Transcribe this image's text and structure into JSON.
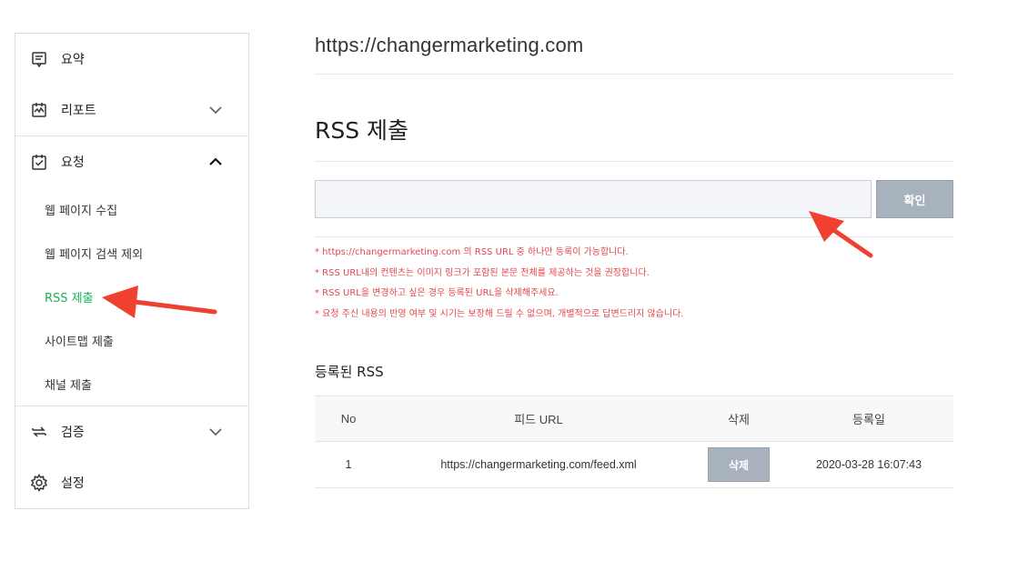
{
  "sidebar": {
    "items": [
      {
        "label": "요약",
        "icon": "summary-icon"
      },
      {
        "label": "리포트",
        "icon": "report-icon"
      },
      {
        "label": "요청",
        "icon": "request-icon"
      },
      {
        "label": "검증",
        "icon": "verify-icon"
      },
      {
        "label": "설정",
        "icon": "settings-icon"
      }
    ],
    "sub_items": [
      {
        "label": "웹 페이지 수집"
      },
      {
        "label": "웹 페이지 검색 제외"
      },
      {
        "label": "RSS 제출"
      },
      {
        "label": "사이트맵 제출"
      },
      {
        "label": "채널 제출"
      }
    ]
  },
  "main": {
    "site_url": "https://changermarketing.com",
    "section_title": "RSS 제출",
    "input": {
      "value": "",
      "placeholder": ""
    },
    "confirm_label": "확인",
    "notes": [
      "* https://changermarketing.com 의 RSS URL 중 하나만 등록이 가능합니다.",
      "* RSS URL내의 컨텐츠는 이미지 링크가 포함된 본문 전체를 제공하는 것을 권장합니다.",
      "* RSS URL을 변경하고 싶은 경우 등록된 URL을 삭제해주세요.",
      "* 요청 주신 내용의 반영 여부 및 시기는 보장해 드릴 수 없으며, 개별적으로 답변드리지 않습니다."
    ],
    "registered_title": "등록된 RSS",
    "table": {
      "headers": {
        "no": "No",
        "feed_url": "피드 URL",
        "delete": "삭제",
        "date": "등록일"
      },
      "rows": [
        {
          "no": "1",
          "feed_url": "https://changermarketing.com/feed.xml",
          "delete_label": "삭제",
          "date": "2020-03-28 16:07:43"
        }
      ]
    }
  },
  "colors": {
    "accent_green": "#19b35a",
    "note_red": "#e4474b",
    "button_gray": "#a8b2bd",
    "annotation_arrow": "#f0402f"
  }
}
